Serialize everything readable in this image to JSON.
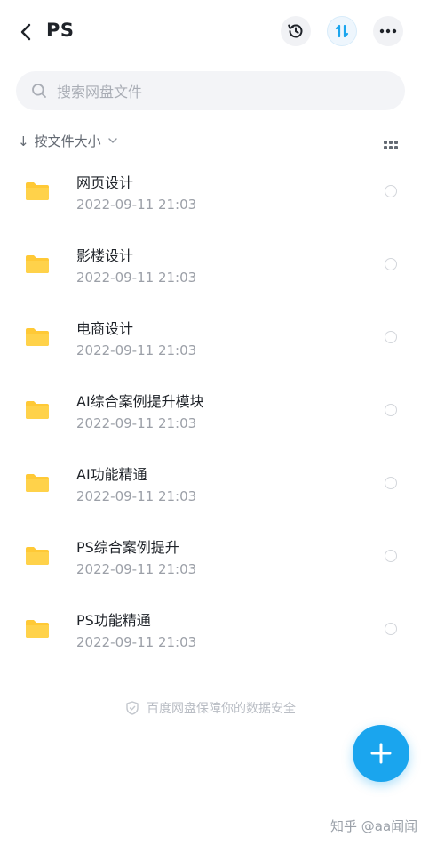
{
  "header": {
    "title": "PS",
    "back_icon": "chevron-left-icon",
    "history_icon": "history-icon",
    "transfer_icon": "transfer-icon",
    "more_icon": "more-dots-icon"
  },
  "search": {
    "placeholder": "搜索网盘文件",
    "icon": "search-icon"
  },
  "sort": {
    "label": "按文件大小",
    "direction_icon": "arrow-down-icon",
    "dropdown_icon": "chevron-down-icon",
    "view_toggle_icon": "grid-view-icon"
  },
  "files": [
    {
      "name": "网页设计",
      "date": "2022-09-11  21:03",
      "icon": "folder-icon"
    },
    {
      "name": "影楼设计",
      "date": "2022-09-11  21:03",
      "icon": "folder-icon"
    },
    {
      "name": "电商设计",
      "date": "2022-09-11  21:03",
      "icon": "folder-icon"
    },
    {
      "name": "AI综合案例提升模块",
      "date": "2022-09-11  21:03",
      "icon": "folder-icon"
    },
    {
      "name": "AI功能精通",
      "date": "2022-09-11  21:03",
      "icon": "folder-icon"
    },
    {
      "name": "PS综合案例提升",
      "date": "2022-09-11  21:03",
      "icon": "folder-icon"
    },
    {
      "name": "PS功能精通",
      "date": "2022-09-11  21:03",
      "icon": "folder-icon"
    }
  ],
  "footer": {
    "security_note": "百度网盘保障你的数据安全",
    "icon": "shield-icon"
  },
  "fab": {
    "icon": "plus-icon"
  },
  "watermark": "知乎 @aa闻闻",
  "colors": {
    "accent": "#1aa5ee",
    "folder": "#ffc936"
  }
}
